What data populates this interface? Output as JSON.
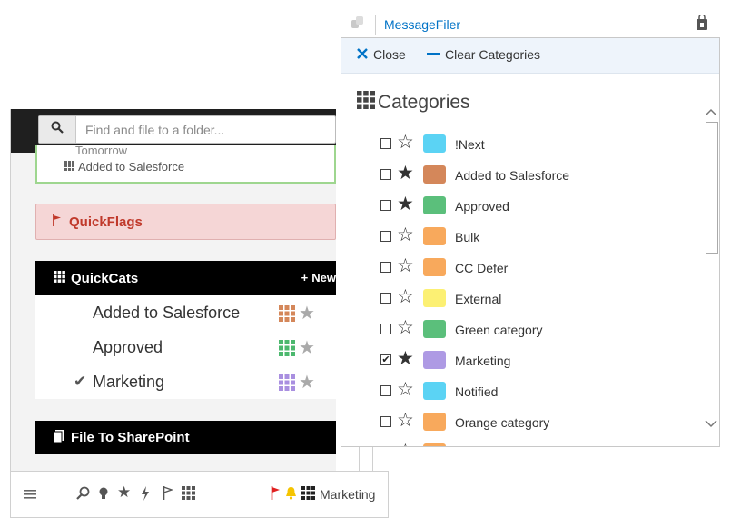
{
  "header": {
    "title": "MessageFiler"
  },
  "search": {
    "placeholder": "Find and file to a folder..."
  },
  "sidebar": {
    "top_card": {
      "cut_text": "Tomorrow",
      "item_label": "Added to Salesforce"
    },
    "quickflags_label": "QuickFlags",
    "quickcats": {
      "title": "QuickCats",
      "new_label": "New",
      "items": [
        {
          "label": "Added to Salesforce",
          "checked": false,
          "color": "#d4875a"
        },
        {
          "label": "Approved",
          "checked": false,
          "color": "#4cb86e"
        },
        {
          "label": "Marketing",
          "checked": true,
          "color": "#a98fe0"
        }
      ]
    },
    "sharepoint_label": "File To SharePoint"
  },
  "bottom_bar": {
    "label": "Marketing",
    "icons": [
      "menu-icon",
      "search-icon",
      "lightbulb-icon",
      "star-icon",
      "lightning-icon",
      "flag-icon",
      "grid-icon",
      "red-flag-icon",
      "bell-icon",
      "category-grid-icon"
    ]
  },
  "popup": {
    "close_label": "Close",
    "clear_label": "Clear Categories",
    "categories_title": "Categories",
    "categories": [
      {
        "name": "!Next",
        "checked": false,
        "starred": false,
        "color": "#5bd3f4"
      },
      {
        "name": "Added to Salesforce",
        "checked": false,
        "starred": true,
        "color": "#d4875a"
      },
      {
        "name": "Approved",
        "checked": false,
        "starred": true,
        "color": "#5bbf7b"
      },
      {
        "name": "Bulk",
        "checked": false,
        "starred": false,
        "color": "#f8a95c"
      },
      {
        "name": "CC Defer",
        "checked": false,
        "starred": false,
        "color": "#f8a95c"
      },
      {
        "name": "External",
        "checked": false,
        "starred": false,
        "color": "#fcf073"
      },
      {
        "name": "Green category",
        "checked": false,
        "starred": false,
        "color": "#5bbf7b"
      },
      {
        "name": "Marketing",
        "checked": true,
        "starred": true,
        "color": "#ae9ae4"
      },
      {
        "name": "Notified",
        "checked": false,
        "starred": false,
        "color": "#5bd3f4"
      },
      {
        "name": "Orange category",
        "checked": false,
        "starred": false,
        "color": "#f8a95c"
      },
      {
        "name": "",
        "checked": false,
        "starred": false,
        "color": "#f8a95c"
      }
    ]
  },
  "colors": {
    "accent_blue": "#0072c6",
    "flag_red": "#c0392b",
    "bell_yellow": "#f5c400"
  }
}
